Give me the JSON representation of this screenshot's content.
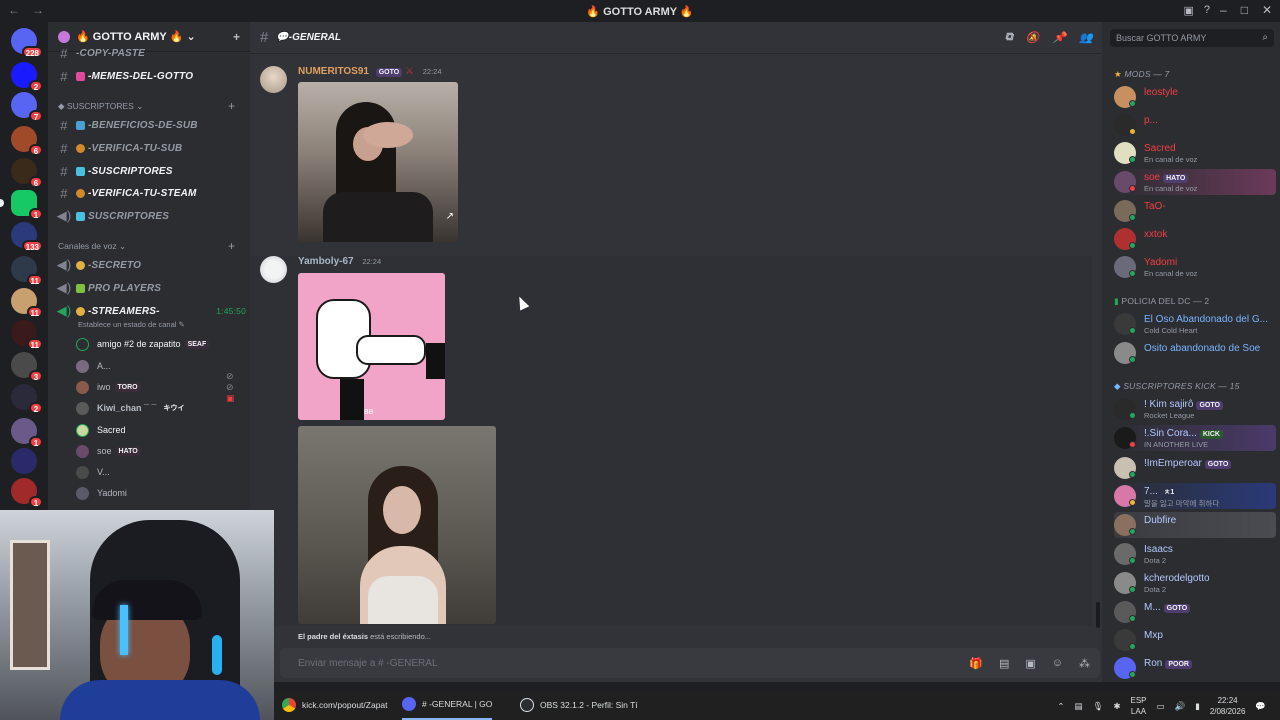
{
  "window": {
    "title": "GOTTO ARMY",
    "nav_back": "←",
    "nav_forward": "→"
  },
  "server_badges": [
    "228",
    "2",
    "7",
    "6",
    "6",
    "1",
    "133",
    "11",
    "11",
    "11",
    "3",
    "2",
    "1",
    "1"
  ],
  "guild": {
    "name": "GOTTO ARMY"
  },
  "channels": {
    "top": [
      {
        "name": "-COPY-PASTE"
      },
      {
        "name": "-MEMES-DEL-GOTTO"
      }
    ],
    "subs_category": "SUSCRIPTORES",
    "subs": [
      {
        "name": "-BENEFICIOS-DE-SUB"
      },
      {
        "name": "-VERIFICA-TU-SUB"
      },
      {
        "name": "-SUSCRIPTORES"
      },
      {
        "name": "-VERIFICA-TU-STEAM"
      },
      {
        "name": "SUSCRIPTORES"
      }
    ],
    "voice_category": "Canales de voz",
    "voice": [
      {
        "name": "-SECRETO"
      },
      {
        "name": "PRO PLAYERS"
      },
      {
        "name": "-STREAMERS-",
        "timer": "1:45:50",
        "status": "Establece un estado de canal"
      }
    ],
    "voice_users": [
      {
        "name": "amigo #2 de zapatito",
        "tag": "SEAF"
      },
      {
        "name": "A..."
      },
      {
        "name": "iwo",
        "tag": "TORO"
      },
      {
        "name": "Kiwi_chan ¯ ¯",
        "tag": "キウイ"
      },
      {
        "name": "Sacred"
      },
      {
        "name": "soe",
        "tag": "HATO"
      },
      {
        "name": "V..."
      },
      {
        "name": "Yadomi"
      }
    ]
  },
  "chat": {
    "channel": "-GENERAL",
    "messages": [
      {
        "user": "NUMERITOS91",
        "role": "GOTO",
        "time": "22:24"
      },
      {
        "user": "Yamboly-67",
        "time": "22:24"
      }
    ],
    "gif_caption": "BB",
    "typing_user": "El padre del éxtasis",
    "typing_text": "está escribiendo...",
    "composer_placeholder": "Enviar mensaje a # -GENERAL"
  },
  "members": {
    "search_placeholder": "Buscar GOTTO ARMY",
    "groups": [
      {
        "title": "MODS — 7"
      },
      {
        "title": "POLICIA DEL DC — 2"
      },
      {
        "title": "SUSCRIPTORES KICK — 15"
      }
    ],
    "mods": [
      {
        "name": "leostyle",
        "sub": ""
      },
      {
        "name": "p...",
        "sub": ""
      },
      {
        "name": "Sacred",
        "sub": "En canal de voz"
      },
      {
        "name": "soe",
        "tag": "HATO",
        "sub": "En canal de voz"
      },
      {
        "name": "TaO-",
        "sub": ""
      },
      {
        "name": "xxtok",
        "sub": ""
      },
      {
        "name": "Yadomi",
        "sub": "En canal de voz"
      }
    ],
    "policia": [
      {
        "name": "El Oso Abandonado del G...",
        "sub": "Cold Cold Heart"
      },
      {
        "name": "Osito abandonado de Soe",
        "sub": ""
      }
    ],
    "kick": [
      {
        "name": "! Kim sajirô",
        "tag": "GOTO",
        "sub": "Rocket League"
      },
      {
        "name": "!.Sin Cora...",
        "tag": "KICK",
        "sub": "IN ANOTHER LIVE"
      },
      {
        "name": "!ImEmperoar",
        "tag": "GOTO",
        "sub": ""
      },
      {
        "name": "7...",
        "tag": "ㅊ1",
        "sub": "말을 잃고 마악에 취하다"
      },
      {
        "name": "Dubfire",
        "sub": ""
      },
      {
        "name": "Isaacs",
        "sub": "Dota 2"
      },
      {
        "name": "kcherodelgotto",
        "sub": "Dota 2"
      },
      {
        "name": "M...",
        "tag": "GOTO",
        "sub": ""
      },
      {
        "name": "Mxp",
        "sub": ""
      },
      {
        "name": "Ron",
        "tag": "POOR",
        "sub": ""
      }
    ]
  },
  "taskbar": {
    "items": [
      {
        "label": "kick.com/popout/Zapat"
      },
      {
        "label": "# -GENERAL | GO"
      },
      {
        "label": "OBS 32.1.2 - Perfil: Sin Tí"
      }
    ],
    "lang": "ESP",
    "lang2": "LAA",
    "time": "22:24",
    "date": "2/08/2026"
  },
  "colors": {
    "accent": "#5865f2",
    "mod_red": "#f23f43",
    "policia_blue": "#7ab4ff",
    "kick_blue": "#b4c8ff"
  }
}
